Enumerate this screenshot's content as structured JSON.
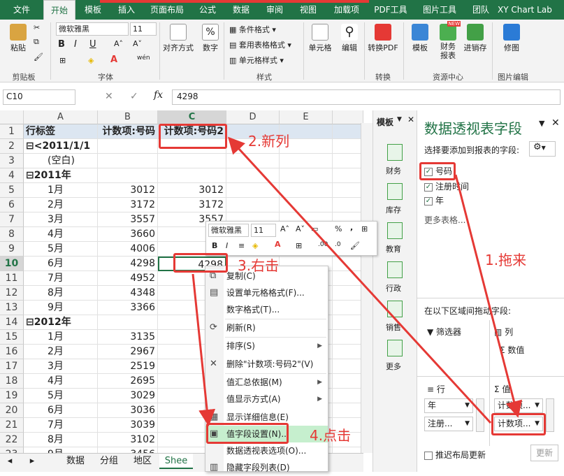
{
  "ribbon_tabs": [
    "文件",
    "开始",
    "模板",
    "插入",
    "页面布局",
    "公式",
    "数据",
    "审阅",
    "视图",
    "加载项",
    "PDF工具",
    "图片工具",
    "团队",
    "XY Chart Lab"
  ],
  "clipboard": {
    "paste": "粘贴",
    "group": "剪贴板"
  },
  "font": {
    "name": "微软雅黑",
    "size": "11",
    "group": "字体",
    "bold": "B",
    "italic": "I",
    "underline": "U",
    "grow": "A˄",
    "shrink": "A˅",
    "pinyin": "wén"
  },
  "alignment": {
    "label": "对齐方式"
  },
  "number": {
    "label": "数字",
    "percent": "%"
  },
  "styles": {
    "cond": "条件格式",
    "table": "套用表格格式",
    "cell": "单元格样式",
    "group": "样式"
  },
  "cells": {
    "label": "单元格"
  },
  "editing": {
    "label": "编辑"
  },
  "convert": {
    "pdf": "转换PDF",
    "group": "转换"
  },
  "resource": {
    "template": "模板",
    "finance": "财务\n报表",
    "invoice": "进销存",
    "group": "资源中心",
    "new_badge": "NEW"
  },
  "image": {
    "fix": "修图",
    "group": "图片编辑"
  },
  "formula_bar": {
    "cell_ref": "C10",
    "fx": "fx",
    "value": "4298"
  },
  "columns": [
    "A",
    "B",
    "C",
    "D",
    "E"
  ],
  "rows": [
    "1",
    "2",
    "3",
    "4",
    "5",
    "6",
    "7",
    "8",
    "9",
    "10",
    "11",
    "12",
    "13",
    "14",
    "15",
    "16",
    "17",
    "18",
    "19",
    "20",
    "21",
    "22",
    "23"
  ],
  "table": [
    {
      "a": "行标签",
      "b": "计数项:号码",
      "c": "计数项:号码2",
      "hdr": true
    },
    {
      "a": "⊟<2011/1/1",
      "b": "",
      "c": "",
      "grp": true
    },
    {
      "a": "(空白)",
      "b": "",
      "c": "",
      "ind": true
    },
    {
      "a": "⊟2011年",
      "b": "",
      "c": "",
      "grp": true
    },
    {
      "a": "1月",
      "b": "3012",
      "c": "3012",
      "ind": true
    },
    {
      "a": "2月",
      "b": "3172",
      "c": "3172",
      "ind": true
    },
    {
      "a": "3月",
      "b": "3557",
      "c": "3557",
      "ind": true
    },
    {
      "a": "4月",
      "b": "3660",
      "c": "3",
      "ind": true
    },
    {
      "a": "5月",
      "b": "4006",
      "c": "4",
      "ind": true
    },
    {
      "a": "6月",
      "b": "4298",
      "c": "4298",
      "ind": true
    },
    {
      "a": "7月",
      "b": "4952",
      "c": "4",
      "ind": true
    },
    {
      "a": "8月",
      "b": "4348",
      "c": "4",
      "ind": true
    },
    {
      "a": "9月",
      "b": "3366",
      "c": "3",
      "ind": true
    },
    {
      "a": "⊟2012年",
      "b": "",
      "c": "",
      "grp": true
    },
    {
      "a": "1月",
      "b": "3135",
      "c": "3",
      "ind": true
    },
    {
      "a": "2月",
      "b": "2967",
      "c": "2",
      "ind": true
    },
    {
      "a": "3月",
      "b": "2519",
      "c": "2",
      "ind": true
    },
    {
      "a": "4月",
      "b": "2695",
      "c": "2",
      "ind": true
    },
    {
      "a": "5月",
      "b": "3029",
      "c": "3",
      "ind": true
    },
    {
      "a": "6月",
      "b": "3036",
      "c": "3",
      "ind": true
    },
    {
      "a": "7月",
      "b": "3039",
      "c": "3",
      "ind": true
    },
    {
      "a": "8月",
      "b": "3102",
      "c": "3",
      "ind": true
    },
    {
      "a": "9月",
      "b": "3456",
      "c": "",
      "ind": true
    }
  ],
  "sheet_tabs": [
    "数据",
    "分组",
    "地区",
    "Shee"
  ],
  "side_tabs": {
    "title": "模板",
    "items": [
      "财务",
      "库存",
      "教育",
      "行政",
      "销售",
      "更多"
    ]
  },
  "pivot": {
    "title": "数据透视表字段",
    "choose": "选择要添加到报表的字段:",
    "fields": [
      "号码",
      "注册时间",
      "年"
    ],
    "more": "更多表格...",
    "drag_hint": "在以下区域间拖动字段:",
    "filter": "筛选器",
    "col": "列",
    "col_value": "Σ 数值",
    "row": "行",
    "val": "Σ 值",
    "row_items": [
      "年",
      "注册..."
    ],
    "val_items": [
      "计数项...",
      "计数项..."
    ],
    "defer": "推迟布局更新",
    "update": "更新"
  },
  "mini_toolbar": {
    "font": "微软雅黑",
    "size": "11"
  },
  "context_menu": [
    "复制(C)",
    "设置单元格格式(F)...",
    "数字格式(T)...",
    "刷新(R)",
    "排序(S)",
    "删除\"计数项:号码2\"(V)",
    "值汇总依据(M)",
    "值显示方式(A)",
    "显示详细信息(E)",
    "值字段设置(N)...",
    "数据透视表选项(O)...",
    "隐藏字段列表(D)"
  ],
  "annotations": {
    "drag": "1.拖来",
    "newcol": "2.新列",
    "rightclick": "3.右击",
    "click": "4.点击"
  },
  "colors": {
    "excel_green": "#217346",
    "annotation_red": "#e53935"
  }
}
